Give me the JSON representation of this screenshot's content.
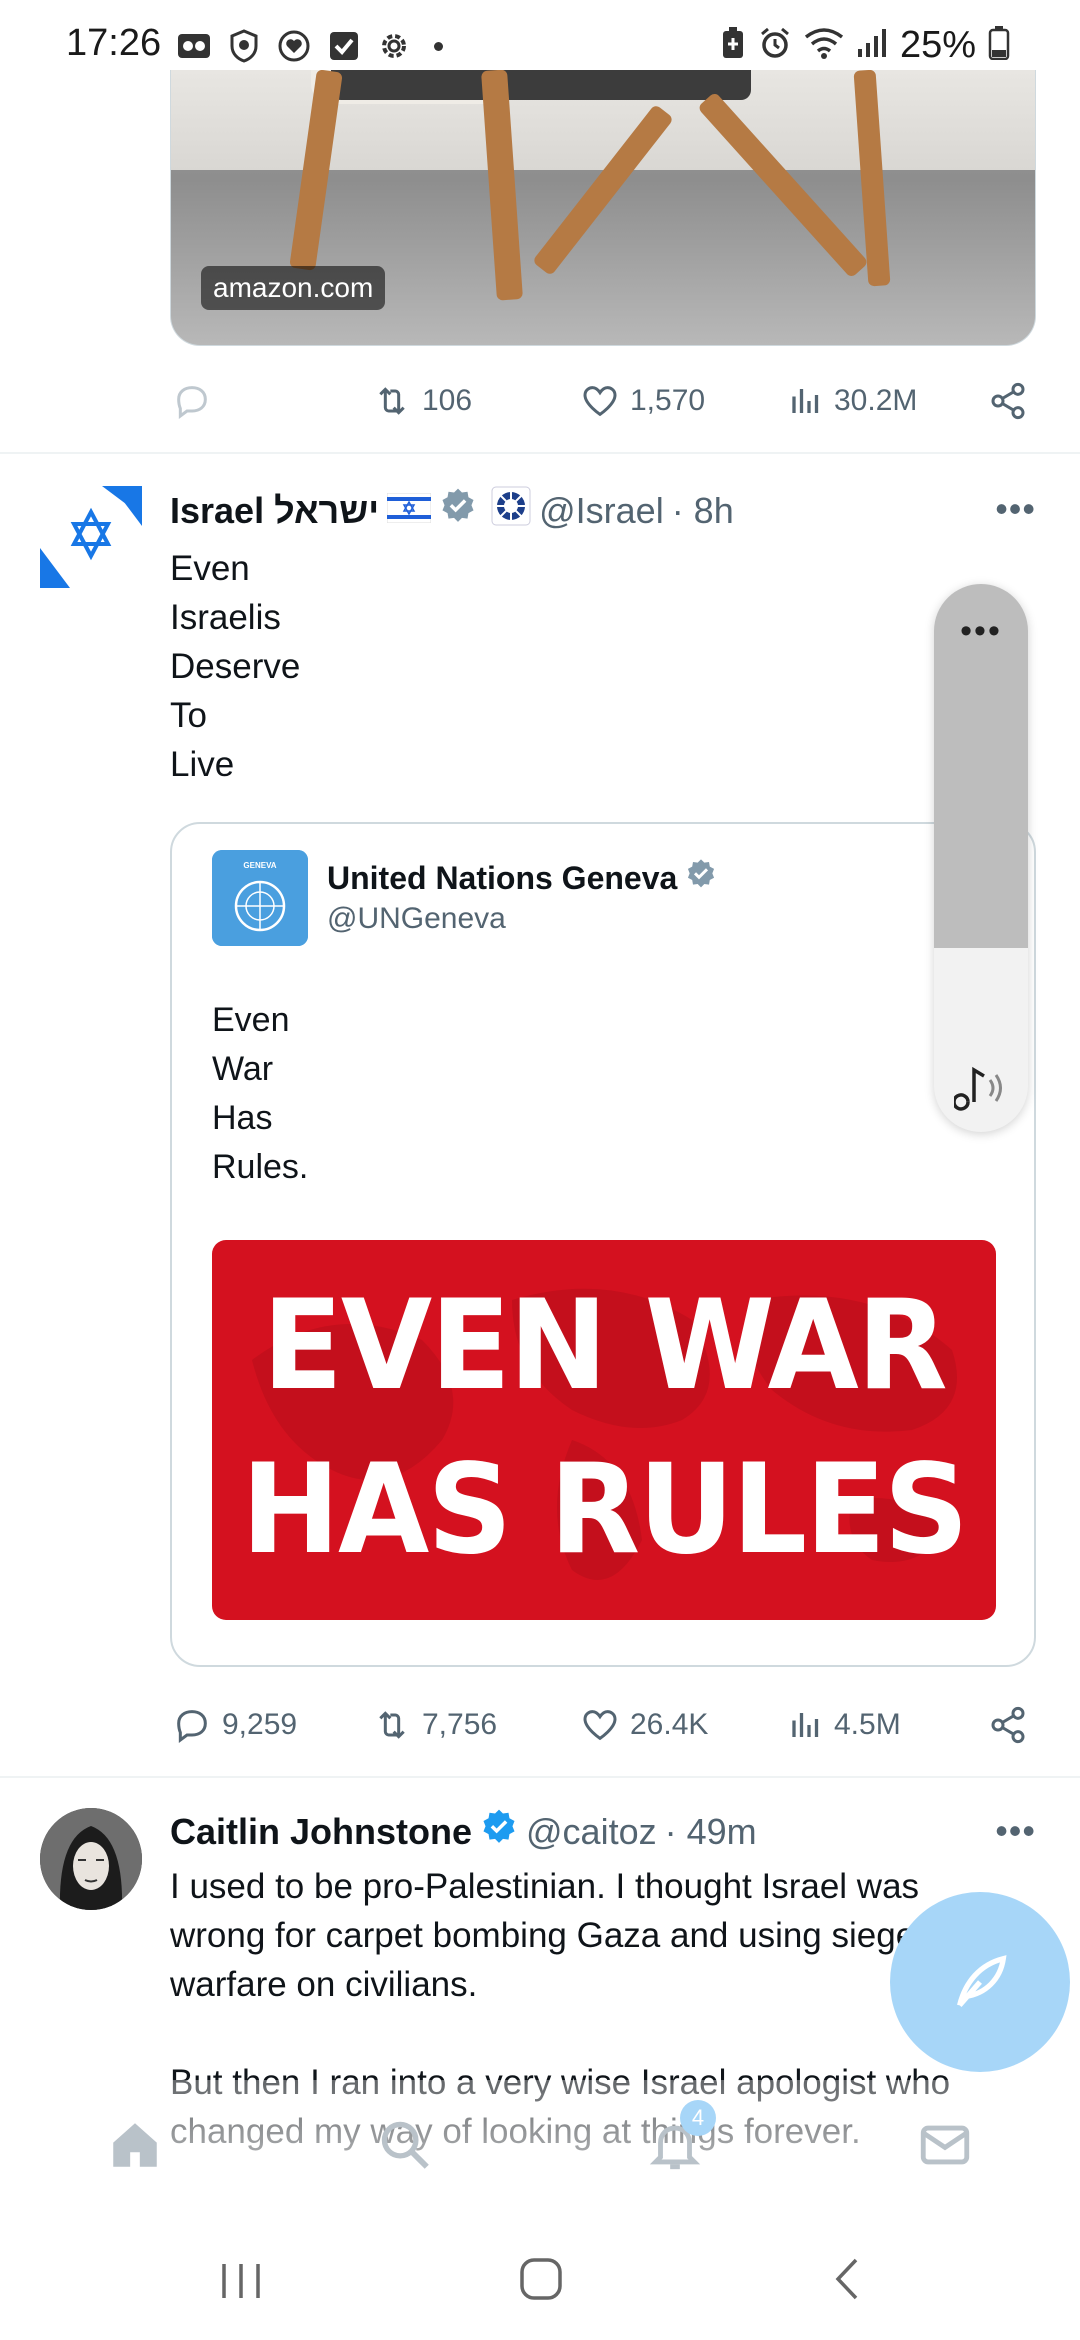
{
  "status_bar": {
    "time": "17:26",
    "battery": "25%",
    "icons_left": [
      "voicemail-icon",
      "shield-icon",
      "heart-circle-icon",
      "check-box-icon",
      "gear-icon"
    ],
    "icons_right": [
      "battery-saver-icon",
      "alarm-icon",
      "wifi-icon",
      "signal-icon",
      "battery-icon"
    ]
  },
  "tweet1": {
    "media_badge": "amazon.com",
    "reply_count": "",
    "retweet_count": "106",
    "like_count": "1,570",
    "view_count": "30.2M"
  },
  "tweet2": {
    "name": "Israel ישראל",
    "handle": "@Israel",
    "time": "· 8h",
    "body_lines": [
      "Even",
      "Israelis",
      "Deserve",
      "To",
      "Live"
    ],
    "quote": {
      "name": "United Nations Geneva",
      "handle": "@UNGeneva",
      "body_lines": [
        "Even",
        "War",
        "Has",
        "Rules."
      ],
      "image_text_line1": "EVEN WAR",
      "image_text_line2": "HAS RULES"
    },
    "reply_count": "9,259",
    "retweet_count": "7,756",
    "like_count": "26.4K",
    "view_count": "4.5M"
  },
  "tweet3": {
    "name": "Caitlin Johnstone",
    "handle": "@caitoz",
    "time": "· 49m",
    "body_p1": "I used to be pro-Palestinian. I thought Israel was wrong for carpet bombing Gaza and using siege warfare on civilians.",
    "body_p2": "But then I ran into a very wise Israel apologist who changed my way of looking at things forever."
  },
  "volume_panel": {
    "more": "•••",
    "level": 0.67
  },
  "bottom_nav": {
    "notification_badge": "4"
  },
  "colors": {
    "accent": "#1d9bf0",
    "muted": "#536471",
    "quote_image_red": "#d4111f",
    "fab": "#a7d6f8"
  }
}
